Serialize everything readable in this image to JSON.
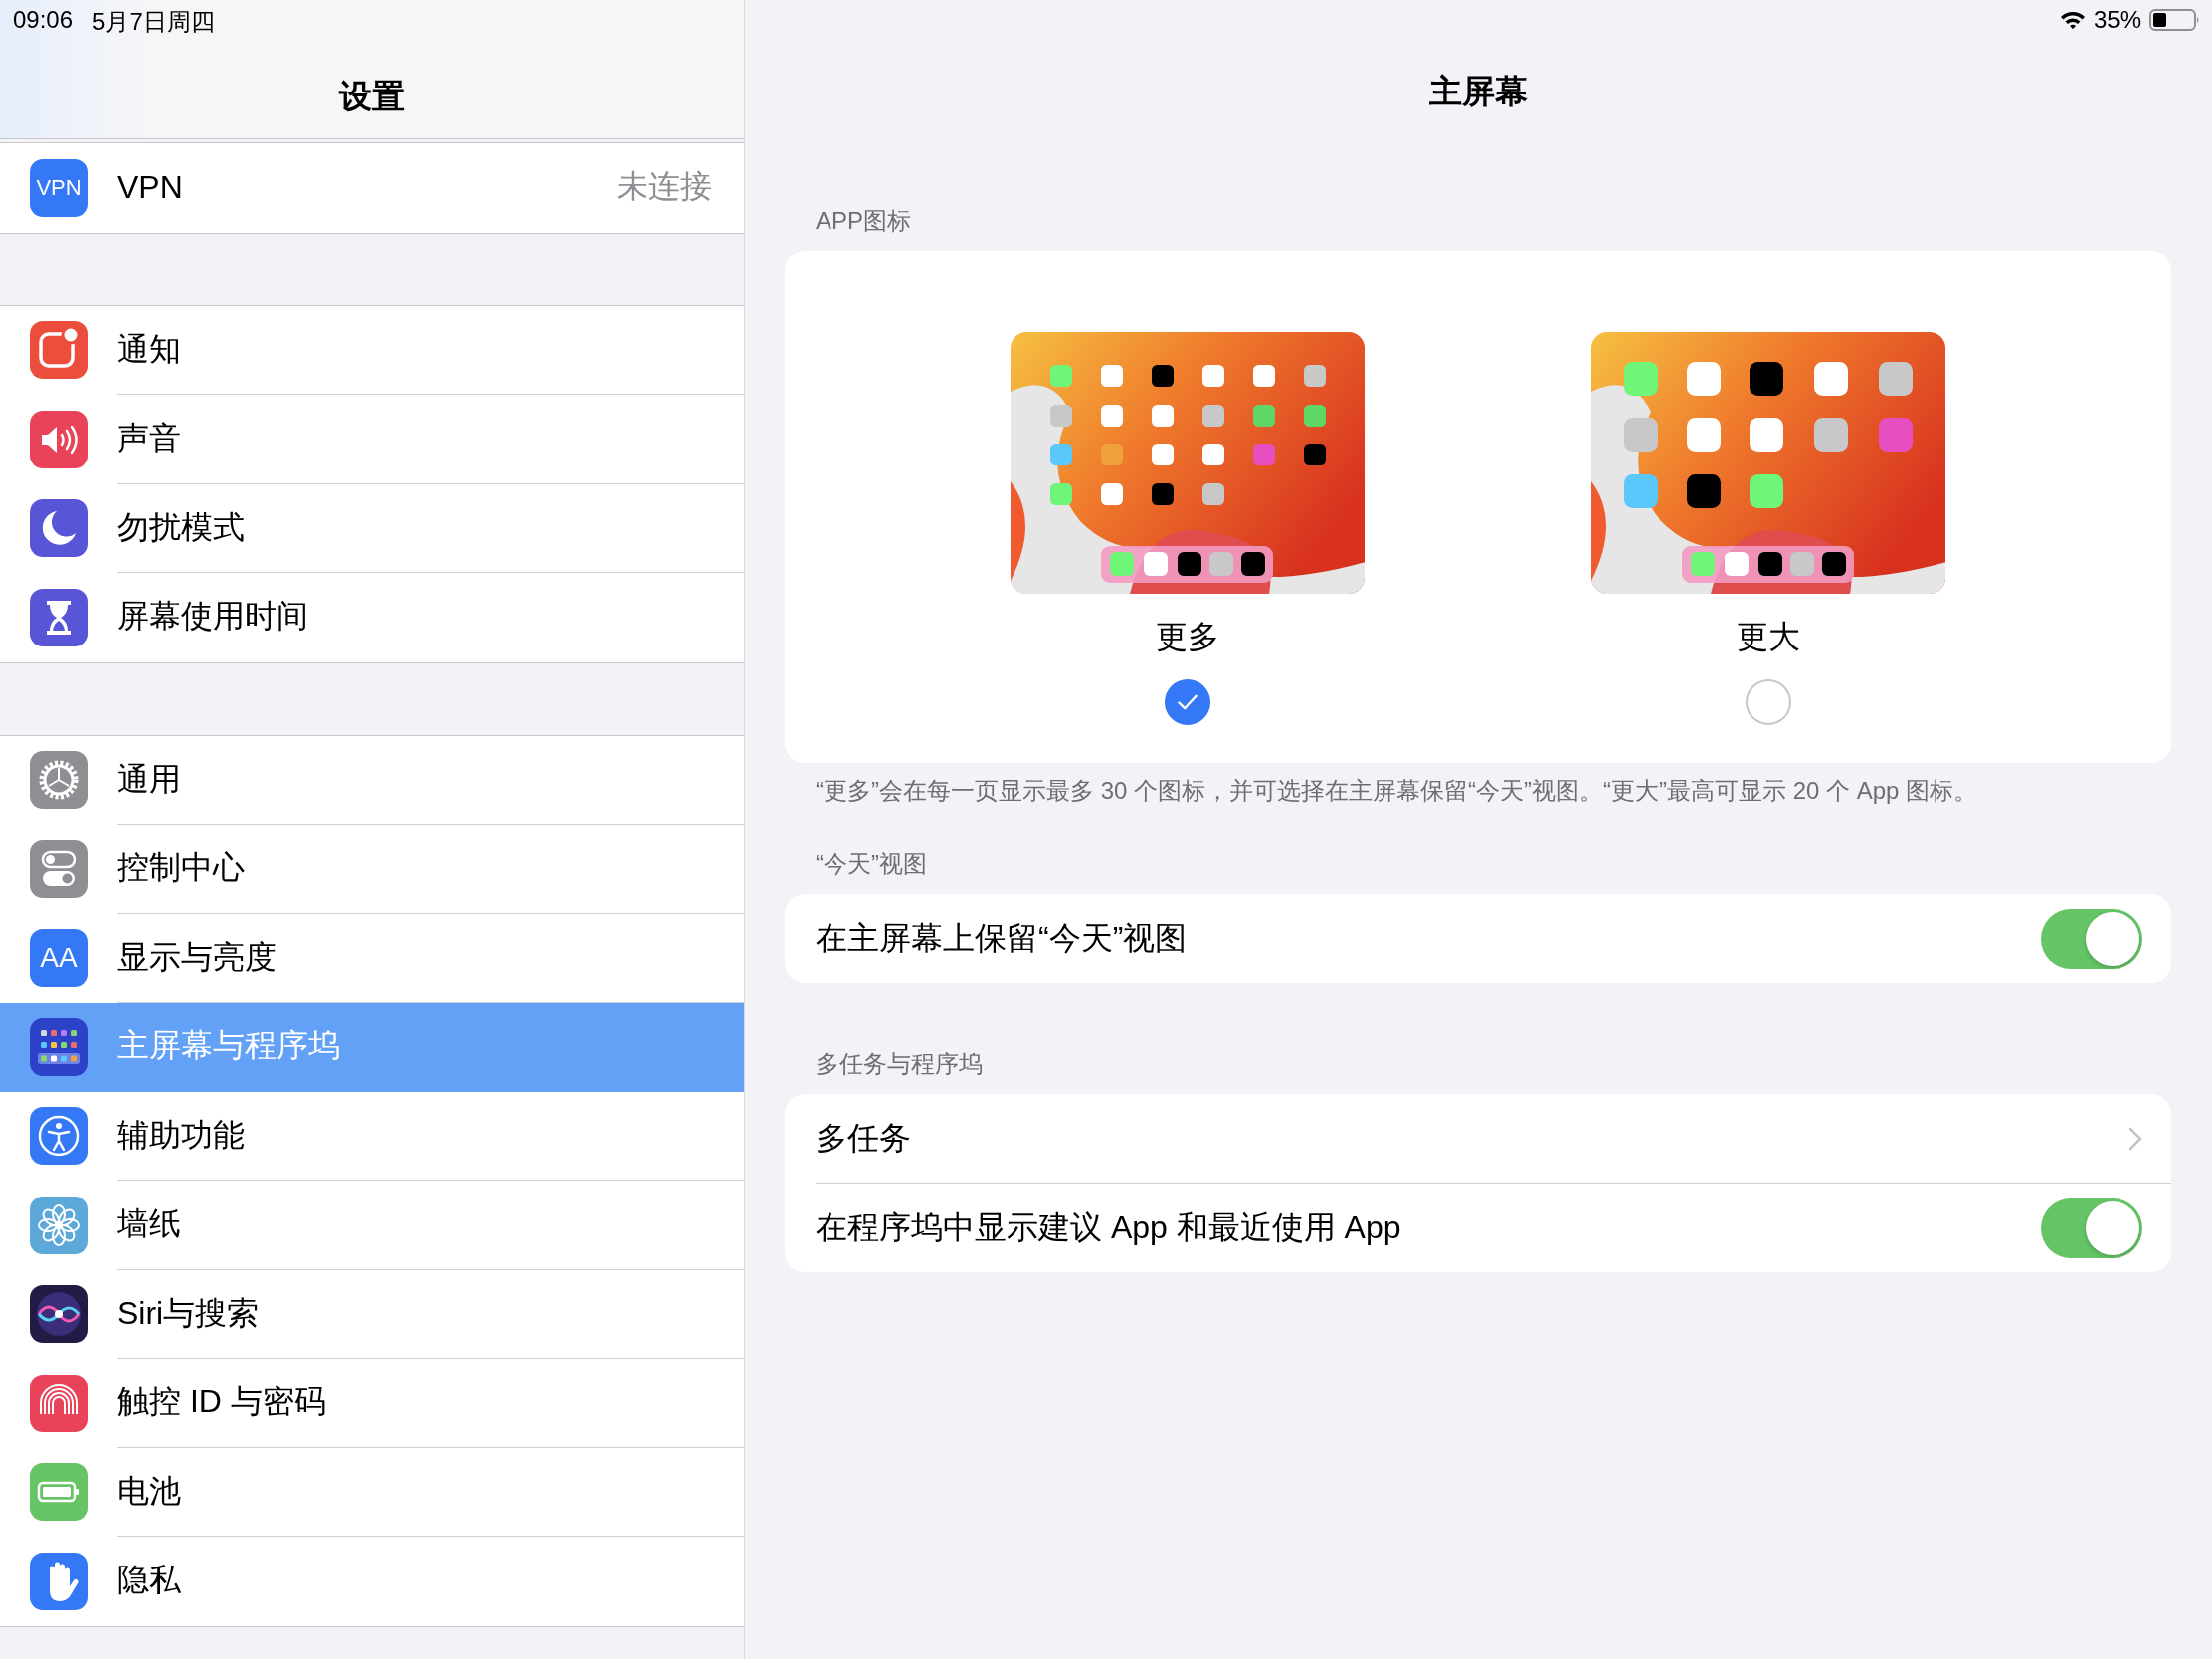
{
  "status_bar": {
    "time": "09:06",
    "date": "5月7日周四",
    "battery_percent": "35%"
  },
  "sidebar": {
    "title": "设置",
    "groups": [
      {
        "items": [
          {
            "label": "VPN",
            "kind": "vpn",
            "color": "#3478f6",
            "icon_text": "VPN",
            "value": "未连接",
            "selected": false
          }
        ]
      },
      {
        "items": [
          {
            "label": "通知",
            "kind": "notifications",
            "color": "#eb4e3d",
            "selected": false
          },
          {
            "label": "声音",
            "kind": "sound",
            "color": "#e9435a",
            "selected": false
          },
          {
            "label": "勿扰模式",
            "kind": "moon",
            "color": "#5856d6",
            "selected": false
          },
          {
            "label": "屏幕使用时间",
            "kind": "hourglass",
            "color": "#5856d6",
            "selected": false
          }
        ]
      },
      {
        "items": [
          {
            "label": "通用",
            "kind": "gear",
            "color": "#8e8e93",
            "selected": false
          },
          {
            "label": "控制中心",
            "kind": "switches",
            "color": "#8e8e93",
            "selected": false
          },
          {
            "label": "显示与亮度",
            "kind": "display",
            "color": "#3478f6",
            "icon_text": "AA",
            "selected": false
          },
          {
            "label": "主屏幕与程序坞",
            "kind": "homescreen",
            "color": "#2c43c9",
            "selected": true
          },
          {
            "label": "辅助功能",
            "kind": "accessibility",
            "color": "#3478f6",
            "selected": false
          },
          {
            "label": "墙纸",
            "kind": "flower",
            "color": "#5ba8d9",
            "selected": false
          },
          {
            "label": "Siri与搜索",
            "kind": "siri",
            "color": "#231b45",
            "selected": false
          },
          {
            "label": "触控 ID 与密码",
            "kind": "fingerprint",
            "color": "#e9435a",
            "selected": false
          },
          {
            "label": "电池",
            "kind": "battery",
            "color": "#65c466",
            "selected": false
          },
          {
            "label": "隐私",
            "kind": "hand",
            "color": "#3478f6",
            "selected": false
          }
        ]
      }
    ]
  },
  "detail": {
    "title": "主屏幕",
    "icon_size": {
      "header": "APP图标",
      "options": [
        {
          "label": "更多",
          "kind": "dense",
          "selected": true
        },
        {
          "label": "更大",
          "kind": "large",
          "selected": false
        }
      ],
      "footer": "“更多”会在每一页显示最多 30 个图标，并可选择在主屏幕保留“今天”视图。“更大”最高可显示 20 个 App 图标。"
    },
    "sections": [
      {
        "header": "“今天”视图",
        "rows": [
          {
            "kind": "toggle",
            "label": "在主屏幕上保留“今天”视图",
            "on": true
          }
        ]
      },
      {
        "header": "多任务与程序坞",
        "rows": [
          {
            "kind": "link",
            "label": "多任务"
          },
          {
            "kind": "toggle",
            "label": "在程序坞中显示建议 App 和最近使用 App",
            "on": true
          }
        ]
      }
    ]
  }
}
